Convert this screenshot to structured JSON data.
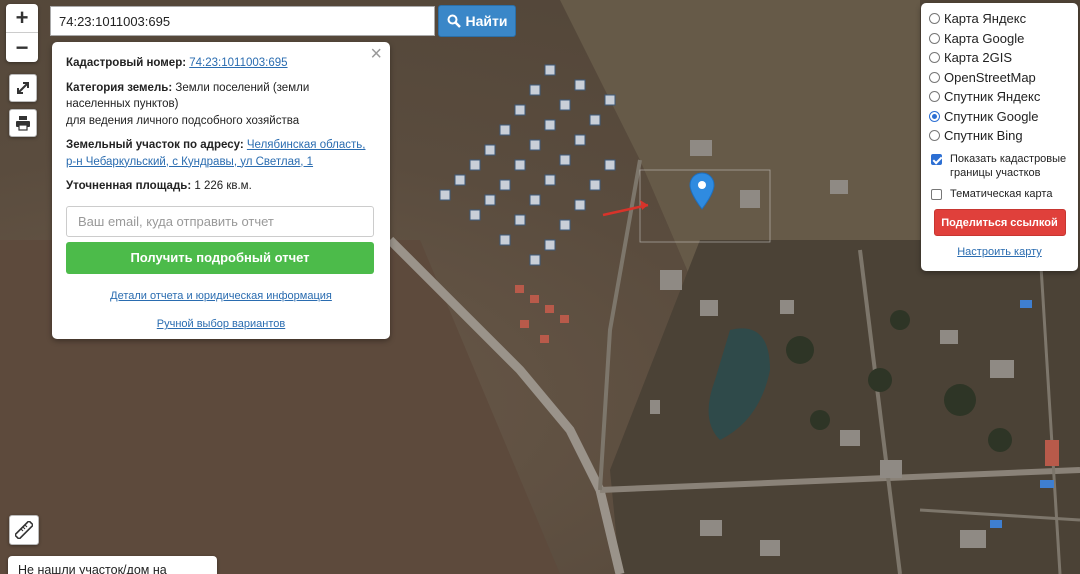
{
  "search": {
    "value": "74:23:1011003:695",
    "button_label": "Найти"
  },
  "zoom": {
    "in_label": "+",
    "out_label": "−"
  },
  "info_panel": {
    "cadastral_label": "Кадастровый номер:",
    "cadastral_value": "74:23:1011003:695",
    "category_label": "Категория земель:",
    "category_value": "Земли поселений (земли населенных пунктов)",
    "usage_value": "для ведения личного подсобного хозяйства",
    "address_label": "Земельный участок по адресу:",
    "address_value": "Челябинская область, р-н Чебаркульский, с Кундравы, ул Светлая, 1",
    "area_label": "Уточненная площадь:",
    "area_value": "1 226 кв.м.",
    "email_placeholder": "Ваш email, куда отправить отчет",
    "report_button": "Получить подробный отчет",
    "details_link": "Детали отчета и юридическая информация",
    "manual_link": "Ручной выбор вариантов",
    "close_symbol": "×"
  },
  "layers": {
    "options": [
      {
        "label": "Карта Яндекс",
        "selected": false
      },
      {
        "label": "Карта Google",
        "selected": false
      },
      {
        "label": "Карта 2GIS",
        "selected": false
      },
      {
        "label": "OpenStreetMap",
        "selected": false
      },
      {
        "label": "Спутник Яндекс",
        "selected": false
      },
      {
        "label": "Спутник Google",
        "selected": true
      },
      {
        "label": "Спутник Bing",
        "selected": false
      }
    ],
    "show_cadastral_label": "Показать кадастровые границы участков",
    "show_cadastral_checked": true,
    "thematic_label": "Тематическая карта",
    "thematic_checked": false,
    "share_button": "Поделиться ссылкой",
    "setup_link": "Настроить карту"
  },
  "bottom": {
    "not_found_label": "Не нашли участок/дом на карте?"
  },
  "colors": {
    "search_button": "#3a87c8",
    "report_button": "#4cbb4a",
    "share_button": "#e0403b",
    "link": "#2a6cb0",
    "map_pin": "#2f8be0"
  }
}
